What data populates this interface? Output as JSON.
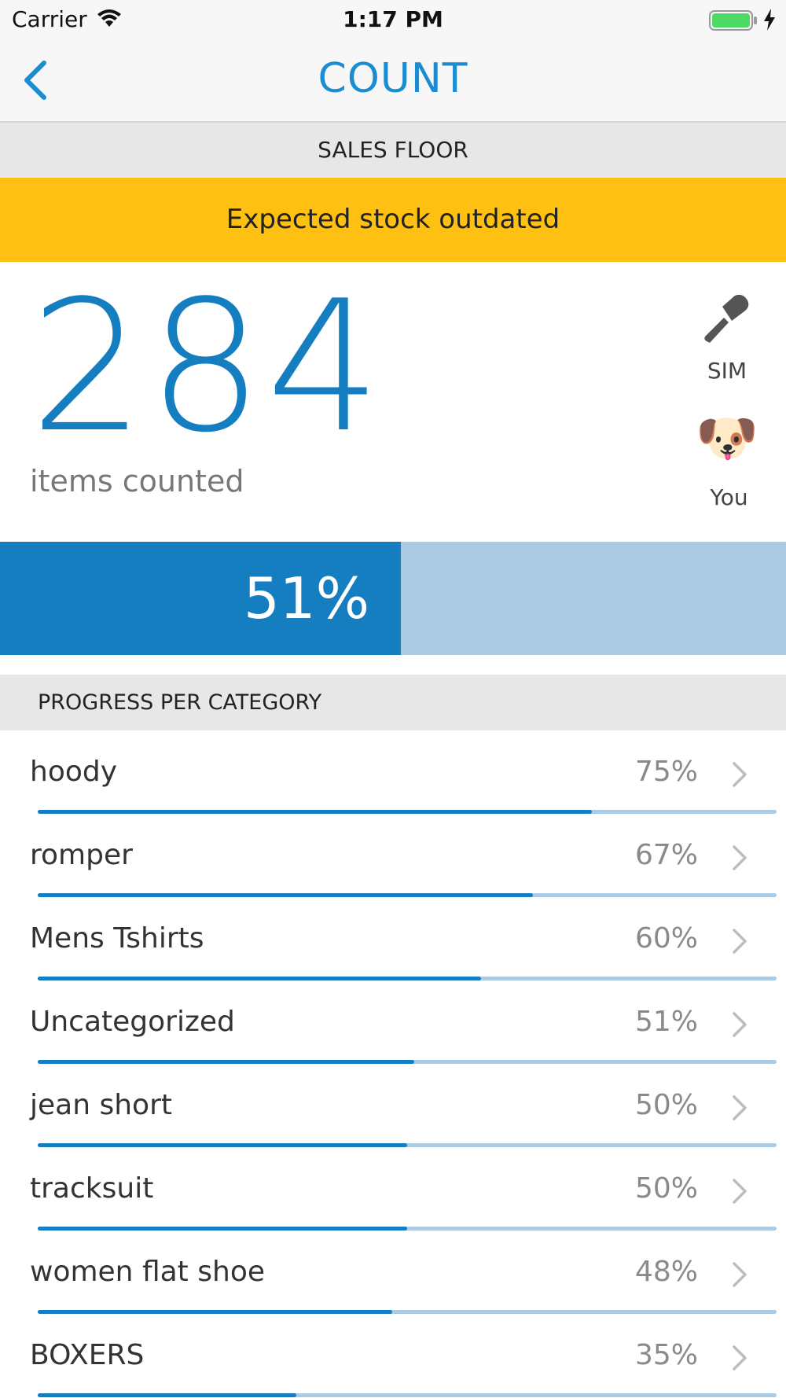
{
  "status_bar": {
    "carrier": "Carrier",
    "time": "1:17 PM",
    "battery_color": "#4cd964"
  },
  "nav": {
    "title": "COUNT",
    "back_icon": "chevron-left-icon"
  },
  "location": "SALES FLOOR",
  "warning": {
    "text": "Expected stock outdated",
    "color": "#fdc013"
  },
  "count": {
    "value": "284",
    "label": "items counted"
  },
  "sources": {
    "sim_label": "SIM",
    "sim_icon": "scanner-icon",
    "you_label": "You",
    "avatar_emoji": "🐶"
  },
  "overall": {
    "percent_text": "51%",
    "fraction": 0.51,
    "fill_color": "#147ec1",
    "track_color": "#abcae3"
  },
  "categories": {
    "header": "PROGRESS PER CATEGORY",
    "items": [
      {
        "name": "hoody",
        "percent_text": "75%",
        "fraction": 0.75
      },
      {
        "name": "romper",
        "percent_text": "67%",
        "fraction": 0.67
      },
      {
        "name": "Mens Tshirts",
        "percent_text": "60%",
        "fraction": 0.6
      },
      {
        "name": "Uncategorized",
        "percent_text": "51%",
        "fraction": 0.51
      },
      {
        "name": "jean short",
        "percent_text": "50%",
        "fraction": 0.5
      },
      {
        "name": "tracksuit",
        "percent_text": "50%",
        "fraction": 0.5
      },
      {
        "name": "women flat shoe",
        "percent_text": "48%",
        "fraction": 0.48
      },
      {
        "name": "BOXERS",
        "percent_text": "35%",
        "fraction": 0.35
      }
    ]
  }
}
